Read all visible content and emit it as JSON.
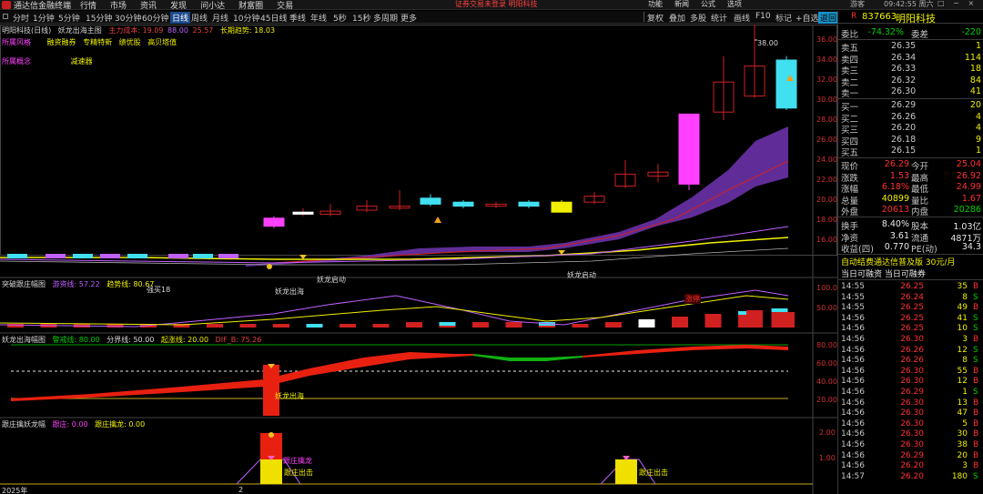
{
  "app": {
    "title": "通达信金融终端",
    "menus": [
      "行情",
      "市场",
      "资讯",
      "发现",
      "问小达",
      "财富圈",
      "交易"
    ],
    "notice": "证券交易未登录   明阳科技",
    "right_menus": [
      "功能",
      "新闻",
      "公式",
      "选项"
    ],
    "user": "游客",
    "clock": "09:42:55 周六",
    "window_buttons": "□ ─ ×"
  },
  "periodbar": {
    "left_items": [
      "分时",
      "1分钟",
      "5分钟",
      "15分钟",
      "30分钟",
      "60分钟",
      "日线",
      "周线",
      "月线",
      "10分钟",
      "45日线",
      "季线",
      "年线",
      "5秒",
      "15秒",
      "多周期",
      "更多"
    ],
    "active": "日线",
    "right_items": [
      "复权",
      "叠加",
      "多股",
      "统计",
      "画线",
      "F10",
      "标记",
      "+自选",
      "返回"
    ],
    "right_active": "返回"
  },
  "main_panel": {
    "stock_label": "明阳科技",
    "period_label": "(日线)",
    "indicator_name": "妖龙出海主图",
    "line1_label": "主力成本: 19.09",
    "line2_value": "88.00",
    "line3_value": "25.57",
    "line4_label": "长期趋势: 18.03",
    "tags_row1": [
      "所属风格",
      "融资融券",
      "专精特新",
      "绩优股",
      "高贝塔值"
    ],
    "tags_row2": [
      "所属概念",
      "减速器"
    ],
    "price_axis": [
      "36.00",
      "34.00",
      "32.00",
      "30.00",
      "28.00",
      "26.00",
      "24.00",
      "22.00",
      "20.00",
      "18.00",
      "16.00"
    ],
    "high_label": "38.00",
    "annotations": {
      "buy_point": "强买18",
      "yaolong": "妖龙出海",
      "start1": "妖龙启动",
      "start2": "妖龙启动",
      "limit_up": "涨停"
    }
  },
  "panel2": {
    "name": "突破跟庄幅图",
    "l1": "游资线: 57.22",
    "l2": "趋势线: 80.67",
    "axis": [
      "100.0",
      "50.00"
    ]
  },
  "panel3": {
    "name": "妖龙出海幅图",
    "l1": "警戒线: 80.00",
    "l2": "分界线: 50.00",
    "l3": "起涨线: 20.00",
    "l4": "DIF_B: 75.26",
    "axis": [
      "80.00",
      "60.00",
      "40.00",
      "20.00"
    ],
    "annot": "妖龙出海"
  },
  "panel4": {
    "name": "跟庄擒妖龙幅",
    "l1": "跟庄: 0.00",
    "l2": "跟庄擒龙: 0.00",
    "axis": [
      "2.00",
      "1.00"
    ],
    "annot1": "跟庄擒龙",
    "annot2": "跟庄出击",
    "annot3": "跟庄出击",
    "year_label": "2025年",
    "year_mark": "2"
  },
  "quote": {
    "market_tag": "R",
    "code": "837663",
    "name": "明阳科技",
    "weibi": {
      "label": "委比",
      "value": "-74.32%",
      "label2": "委差",
      "value2": "-220"
    },
    "asks": [
      {
        "label": "卖五",
        "price": "26.35",
        "vol": "1"
      },
      {
        "label": "卖四",
        "price": "26.34",
        "vol": "114"
      },
      {
        "label": "卖三",
        "price": "26.33",
        "vol": "18"
      },
      {
        "label": "卖二",
        "price": "26.32",
        "vol": "84"
      },
      {
        "label": "卖一",
        "price": "26.30",
        "vol": "41"
      }
    ],
    "bids": [
      {
        "label": "买一",
        "price": "26.29",
        "vol": "20"
      },
      {
        "label": "买二",
        "price": "26.26",
        "vol": "4"
      },
      {
        "label": "买三",
        "price": "26.20",
        "vol": "4"
      },
      {
        "label": "买四",
        "price": "26.18",
        "vol": "9"
      },
      {
        "label": "买五",
        "price": "26.15",
        "vol": "1"
      }
    ],
    "stats": [
      {
        "l1": "现价",
        "v1": "26.29",
        "c1": "red",
        "l2": "今开",
        "v2": "25.04",
        "c2": "red"
      },
      {
        "l1": "涨跌",
        "v1": "1.53",
        "c1": "red",
        "l2": "最高",
        "v2": "26.92",
        "c2": "red"
      },
      {
        "l1": "涨幅",
        "v1": "6.18%",
        "c1": "red",
        "l2": "最低",
        "v2": "24.99",
        "c2": "red"
      },
      {
        "l1": "总量",
        "v1": "40899",
        "c1": "yellow",
        "l2": "量比",
        "v2": "1.67",
        "c2": "red"
      },
      {
        "l1": "外盘",
        "v1": "20613",
        "c1": "red",
        "l2": "内盘",
        "v2": "20286",
        "c2": "green"
      }
    ],
    "stats2": [
      {
        "l1": "换手",
        "v1": "8.40%",
        "c1": "white",
        "l2": "股本",
        "v2": "1.03亿",
        "c2": "white"
      },
      {
        "l1": "净资",
        "v1": "3.61",
        "c1": "white",
        "l2": "流通",
        "v2": "4871万",
        "c2": "white"
      },
      {
        "l1": "收益(四)",
        "v1": "0.770",
        "c1": "white",
        "l2": "PE(动)",
        "v2": "34.3",
        "c2": "white"
      }
    ],
    "promo": "自动结费通达信普及版  30元/月",
    "promo2": "当日可融资  当日可融券",
    "ticks": [
      {
        "t": "14:55",
        "p": "26.25",
        "v": "35",
        "s": "B"
      },
      {
        "t": "14:55",
        "p": "26.24",
        "v": "8",
        "s": "S"
      },
      {
        "t": "14:55",
        "p": "26.25",
        "v": "49",
        "s": "B"
      },
      {
        "t": "14:56",
        "p": "26.25",
        "v": "41",
        "s": "S"
      },
      {
        "t": "14:56",
        "p": "26.25",
        "v": "10",
        "s": "S"
      },
      {
        "t": "14:56",
        "p": "26.30",
        "v": "3",
        "s": "B"
      },
      {
        "t": "14:56",
        "p": "26.26",
        "v": "12",
        "s": "S"
      },
      {
        "t": "14:56",
        "p": "26.26",
        "v": "8",
        "s": "S"
      },
      {
        "t": "14:56",
        "p": "26.30",
        "v": "55",
        "s": "B"
      },
      {
        "t": "14:56",
        "p": "26.30",
        "v": "12",
        "s": "B"
      },
      {
        "t": "14:56",
        "p": "26.29",
        "v": "1",
        "s": "S"
      },
      {
        "t": "14:56",
        "p": "26.30",
        "v": "13",
        "s": "B"
      },
      {
        "t": "14:56",
        "p": "26.30",
        "v": "47",
        "s": "B"
      },
      {
        "t": "14:56",
        "p": "26.30",
        "v": "5",
        "s": "B"
      },
      {
        "t": "14:56",
        "p": "26.30",
        "v": "30",
        "s": "B"
      },
      {
        "t": "14:56",
        "p": "26.30",
        "v": "38",
        "s": "B"
      },
      {
        "t": "14:56",
        "p": "26.29",
        "v": "20",
        "s": "B"
      },
      {
        "t": "14:56",
        "p": "26.20",
        "v": "3",
        "s": "B"
      },
      {
        "t": "14:57",
        "p": "26.20",
        "v": "180",
        "s": "S"
      }
    ]
  }
}
